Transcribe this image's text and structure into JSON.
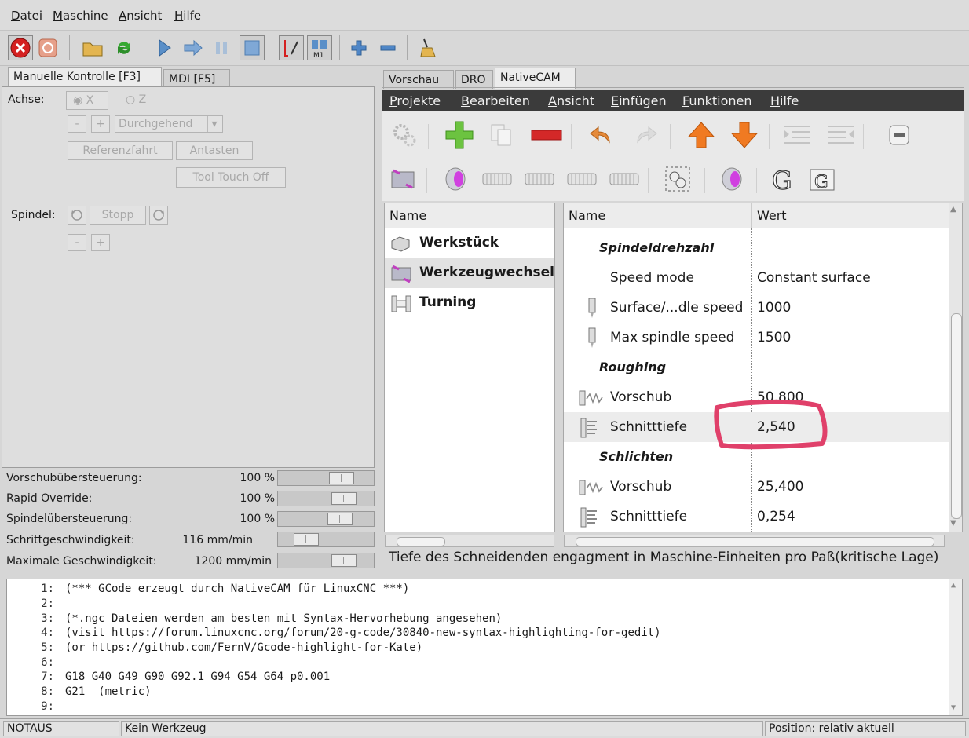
{
  "menubar": [
    "Datei",
    "Maschine",
    "Ansicht",
    "Hilfe"
  ],
  "left_tabs": {
    "manual": "Manuelle Kontrolle [F3]",
    "mdi": "MDI [F5]"
  },
  "manual": {
    "axis_label": "Achse:",
    "axis_x": "X",
    "axis_z": "Z",
    "minus": "-",
    "plus": "+",
    "jog_mode": "Durchgehend",
    "home_btn": "Referenzfahrt",
    "touch_btn": "Antasten",
    "tool_touch_btn": "Tool Touch Off",
    "spindle_label": "Spindel:",
    "spindle_stop": "Stopp"
  },
  "overrides": [
    {
      "label": "Vorschubübersteuerung:",
      "value": "100 %",
      "level": 0.72
    },
    {
      "label": "Rapid Override:",
      "value": "100 %",
      "level": 0.76
    },
    {
      "label": "Spindelübersteuerung:",
      "value": "100 %",
      "level": 0.7
    },
    {
      "label": "Schrittgeschwindigkeit:",
      "value": "116 mm/min",
      "level": 0.22
    },
    {
      "label": "Maximale Geschwindigkeit:",
      "value": "1200 mm/min",
      "level": 0.76
    }
  ],
  "right_tabs": {
    "preview": "Vorschau",
    "dro": "DRO",
    "nativecam": "NativeCAM"
  },
  "nc_menu": [
    "Projekte",
    "Bearbeiten",
    "Ansicht",
    "Einfügen",
    "Funktionen",
    "Hilfe"
  ],
  "tree": {
    "header": "Name",
    "items": [
      "Werkstück",
      "Werkzeugwechsel",
      "Turning"
    ]
  },
  "props": {
    "col_name": "Name",
    "col_value": "Wert",
    "rows": [
      {
        "name": "Spindeldrehzahl",
        "value": "",
        "section": true
      },
      {
        "name": "Speed mode",
        "value": "Constant surface",
        "section": false,
        "icon": "none"
      },
      {
        "name": "Surface/...dle speed",
        "value": "1000",
        "section": false,
        "icon": "spindle"
      },
      {
        "name": "Max spindle speed",
        "value": "1500",
        "section": false,
        "icon": "spindle"
      },
      {
        "name": "Roughing",
        "value": "",
        "section": true
      },
      {
        "name": "Vorschub",
        "value": "50,800",
        "section": false,
        "icon": "feed"
      },
      {
        "name": "Schnitttiefe",
        "value": "2,540",
        "section": false,
        "icon": "depth",
        "selected": true
      },
      {
        "name": "Schlichten",
        "value": "",
        "section": true
      },
      {
        "name": "Vorschub",
        "value": "25,400",
        "section": false,
        "icon": "feed"
      },
      {
        "name": "Schnitttiefe",
        "value": "0,254",
        "section": false,
        "icon": "depth"
      }
    ]
  },
  "nc_status": "Tiefe des Schneidenden engagment in Maschine-Einheiten pro Paß(kritische Lage)",
  "gcode": [
    {
      "n": "1:",
      "t": "(*** GCode erzeugt durch NativeCAM für LinuxCNC ***)"
    },
    {
      "n": "2:",
      "t": ""
    },
    {
      "n": "3:",
      "t": "(*.ngc Dateien werden am besten mit Syntax-Hervorhebung angesehen)"
    },
    {
      "n": "4:",
      "t": "(visit https://forum.linuxcnc.org/forum/20-g-code/30840-new-syntax-highlighting-for-gedit)"
    },
    {
      "n": "5:",
      "t": "(or https://github.com/FernV/Gcode-highlight-for-Kate)"
    },
    {
      "n": "6:",
      "t": ""
    },
    {
      "n": "7:",
      "t": "G18 G40 G49 G90 G92.1 G94 G54 G64 p0.001"
    },
    {
      "n": "8:",
      "t": "G21  (metric)"
    },
    {
      "n": "9:",
      "t": ""
    }
  ],
  "statusbar": {
    "estop": "NOTAUS",
    "tool": "Kein Werkzeug",
    "position": "Position: relativ aktuell"
  },
  "colors": {
    "highlight_circle": "#e0406a",
    "estop_red": "#d42020",
    "nc_menubar": "#3b3b3b"
  }
}
